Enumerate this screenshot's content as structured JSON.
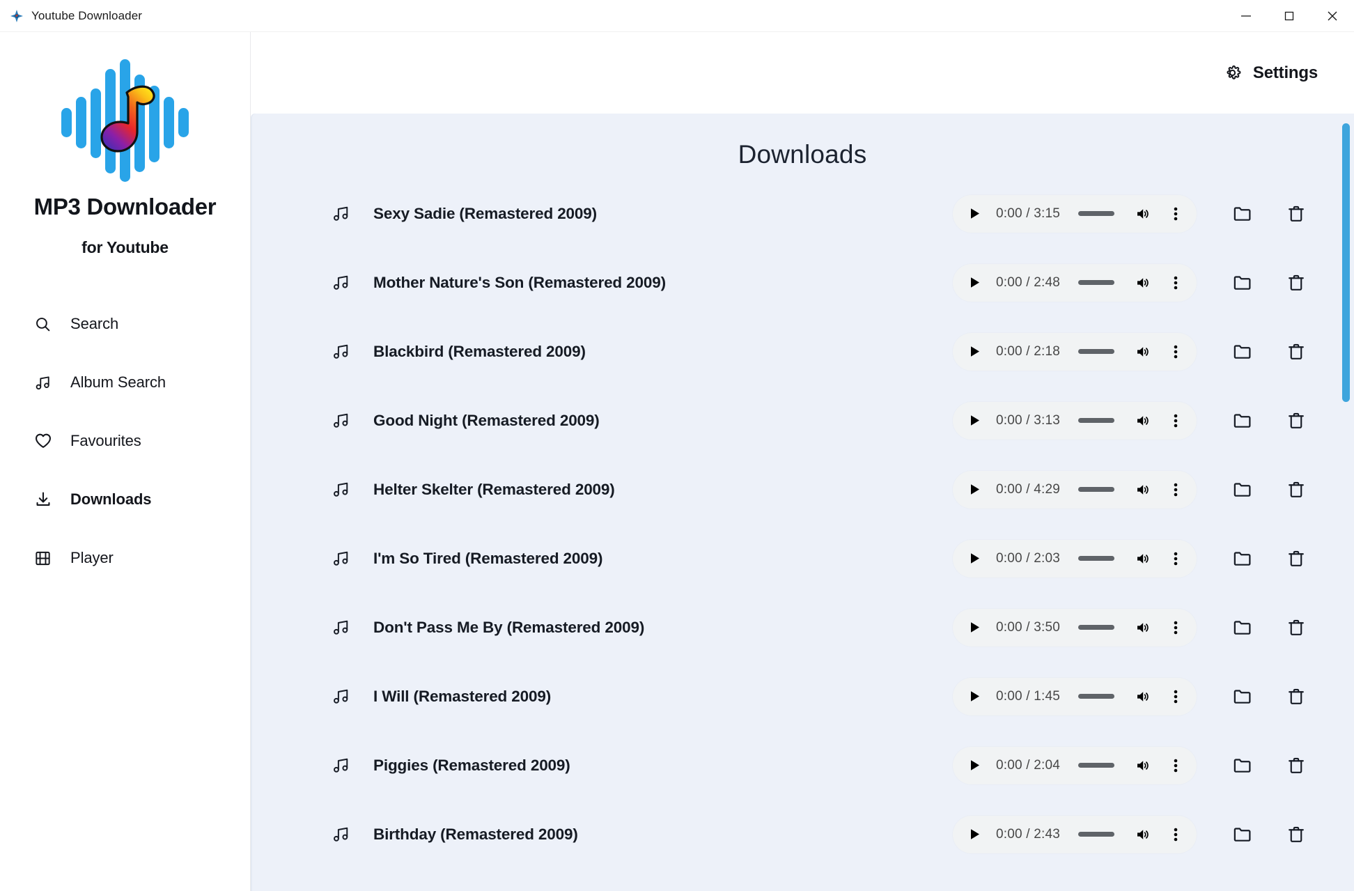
{
  "window": {
    "title": "Youtube Downloader",
    "app_icon": "app-logo-icon",
    "controls": {
      "minimize": "minimize-icon",
      "maximize": "maximize-icon",
      "close": "close-icon"
    }
  },
  "sidebar": {
    "logo_icon": "waveform-music-note-logo",
    "brand_title": "MP3 Downloader",
    "brand_subtitle": "for Youtube",
    "items": [
      {
        "label": "Search",
        "icon": "search-icon",
        "active": false
      },
      {
        "label": "Album Search",
        "icon": "music-note-icon",
        "active": false
      },
      {
        "label": "Favourites",
        "icon": "heart-icon",
        "active": false
      },
      {
        "label": "Downloads",
        "icon": "download-icon",
        "active": true
      },
      {
        "label": "Player",
        "icon": "film-strip-icon",
        "active": false
      }
    ]
  },
  "topbar": {
    "settings_label": "Settings",
    "settings_icon": "gear-icon"
  },
  "main": {
    "title": "Downloads",
    "player_controls": {
      "play_icon": "play-icon",
      "volume_icon": "volume-high-icon",
      "menu_icon": "three-dots-vertical-icon",
      "folder_icon": "folder-icon",
      "delete_icon": "trash-icon",
      "note_icon": "music-note-icon"
    },
    "tracks": [
      {
        "title": "Sexy Sadie (Remastered 2009)",
        "time": "0:00 / 3:15"
      },
      {
        "title": "Mother Nature's Son (Remastered 2009)",
        "time": "0:00 / 2:48"
      },
      {
        "title": "Blackbird (Remastered 2009)",
        "time": "0:00 / 2:18"
      },
      {
        "title": "Good Night (Remastered 2009)",
        "time": "0:00 / 3:13"
      },
      {
        "title": "Helter Skelter (Remastered 2009)",
        "time": "0:00 / 4:29"
      },
      {
        "title": "I'm So Tired (Remastered 2009)",
        "time": "0:00 / 2:03"
      },
      {
        "title": "Don't Pass Me By (Remastered 2009)",
        "time": "0:00 / 3:50"
      },
      {
        "title": "I Will (Remastered 2009)",
        "time": "0:00 / 1:45"
      },
      {
        "title": "Piggies (Remastered 2009)",
        "time": "0:00 / 2:04"
      },
      {
        "title": "Birthday (Remastered 2009)",
        "time": "0:00 / 2:43"
      }
    ]
  },
  "theme": {
    "panel_bg": "#edf1f9",
    "scrollbar": "#3ea5dd",
    "text": "#161b24",
    "player_bg": "#f1f3f4"
  }
}
